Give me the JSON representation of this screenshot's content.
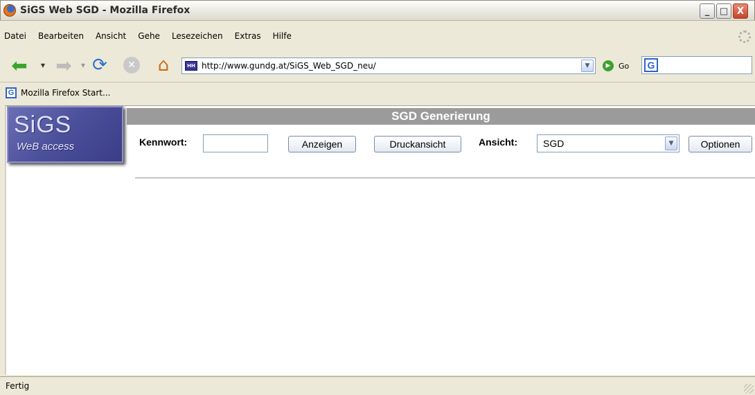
{
  "window": {
    "title": "SiGS Web SGD - Mozilla Firefox",
    "min_glyph": "_",
    "max_glyph": "□",
    "close_glyph": "X"
  },
  "menu": {
    "items": [
      "Datei",
      "Bearbeiten",
      "Ansicht",
      "Gehe",
      "Lesezeichen",
      "Extras",
      "Hilfe"
    ]
  },
  "navbar": {
    "url": "http://www.gundg.at/SiGS_Web_SGD_neu/",
    "go_label": "Go",
    "search_value": ""
  },
  "bookmarks": {
    "items": [
      "Mozilla Firefox Start..."
    ]
  },
  "page": {
    "logo_main": "SiGS",
    "logo_sub": "WeB access",
    "header_title": "SGD Generierung",
    "kennwort_label": "Kennwort:",
    "kennwort_value": "",
    "anzeigen_label": "Anzeigen",
    "druckansicht_label": "Druckansicht",
    "ansicht_label": "Ansicht:",
    "ansicht_selected": "SGD",
    "optionen_label": "Optionen"
  },
  "status": {
    "text": "Fertig"
  },
  "colors": {
    "header_band": "#9b9b9b",
    "logo_bg": "#4b4f9a",
    "chrome_bg": "#ece9d8"
  }
}
